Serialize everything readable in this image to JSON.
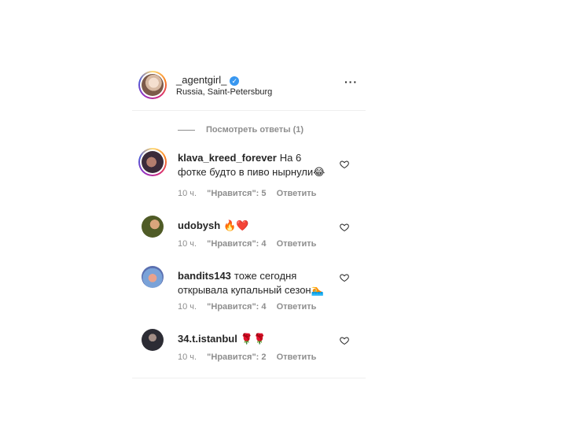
{
  "post": {
    "username": "_agentgirl_",
    "location": "Russia, Saint-Petersburg",
    "more_label": "···"
  },
  "view_replies": "Посмотреть ответы (1)",
  "comments": [
    {
      "username": "klava_kreed_forever",
      "text": "На 6 фотке будто в пиво нырнули😂",
      "time": "10 ч.",
      "likes": "\"Нравится\": 5",
      "reply": "Ответить"
    },
    {
      "username": "udobysh",
      "text": "🔥❤️",
      "time": "10 ч.",
      "likes": "\"Нравится\": 4",
      "reply": "Ответить"
    },
    {
      "username": "bandits143",
      "text": "тоже сегодня открывала купальный сезон🏊",
      "time": "10 ч.",
      "likes": "\"Нравится\": 4",
      "reply": "Ответить"
    },
    {
      "username": "34.t.istanbul",
      "text": "🌹🌹",
      "time": "10 ч.",
      "likes": "\"Нравится\": 2",
      "reply": "Ответить"
    }
  ]
}
